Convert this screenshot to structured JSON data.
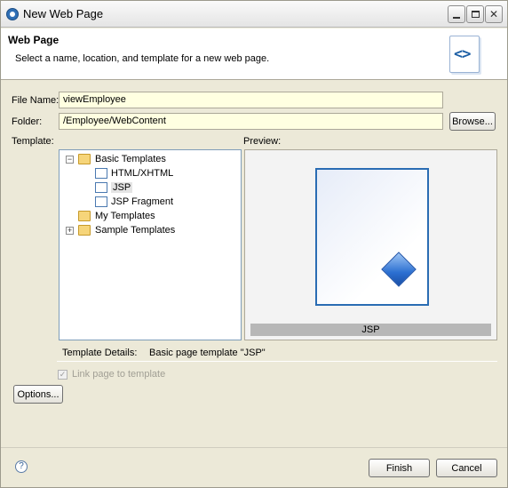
{
  "window": {
    "title": "New Web Page",
    "buttons": {
      "minimize_icon": "minimize-icon",
      "maximize_icon": "maximize-icon",
      "close": "✕"
    }
  },
  "banner": {
    "title": "Web Page",
    "description": "Select a name, location, and template for a new web page.",
    "icon": "<>"
  },
  "form": {
    "file_name_label": "File Name:",
    "file_name_value": "viewEmployee",
    "folder_label": "Folder:",
    "folder_value": "/Employee/WebContent",
    "browse_label": "Browse...",
    "template_label": "Template:",
    "preview_label": "Preview:"
  },
  "tree": {
    "items": [
      {
        "label": "Basic Templates",
        "type": "folder",
        "expanded": true
      },
      {
        "label": "HTML/XHTML",
        "type": "file"
      },
      {
        "label": "JSP",
        "type": "file",
        "selected": true
      },
      {
        "label": "JSP Fragment",
        "type": "file"
      },
      {
        "label": "My Templates",
        "type": "folder"
      },
      {
        "label": "Sample Templates",
        "type": "folder",
        "expanded": false
      }
    ]
  },
  "preview": {
    "caption": "JSP"
  },
  "details": {
    "label": "Template Details:",
    "value": "Basic page template \"JSP\""
  },
  "options": {
    "link_label": "Link page to template",
    "link_checked": true,
    "options_button": "Options..."
  },
  "footer": {
    "help": "?",
    "finish": "Finish",
    "cancel": "Cancel"
  },
  "colors": {
    "field_bg": "#ffffe1",
    "accent": "#2a6cb3",
    "dialog_bg": "#ece9d8"
  }
}
